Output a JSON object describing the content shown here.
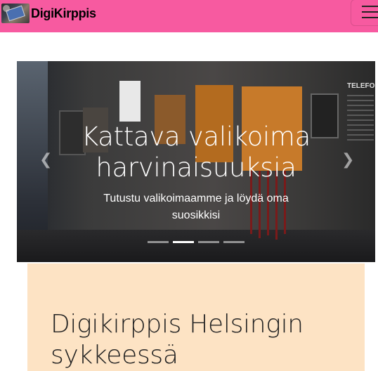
{
  "navbar": {
    "brand_text": "DigiKirppis",
    "logo_icon": "phone-logo-icon",
    "menu_icon": "hamburger-menu-icon",
    "background": "#f75aa0"
  },
  "carousel": {
    "title": "Kattava valikoima harvinaisuuksia",
    "subtitle": "Tutustu valikoimaamme ja löydä oma suosikkisi",
    "photo_sign": "TELEFON",
    "prev_icon": "chevron-left-icon",
    "next_icon": "chevron-right-icon",
    "slide_count": 4,
    "active_slide": 2
  },
  "info": {
    "title": "Digikirppis Helsingin sykkeessä",
    "background": "#fde3c4"
  }
}
